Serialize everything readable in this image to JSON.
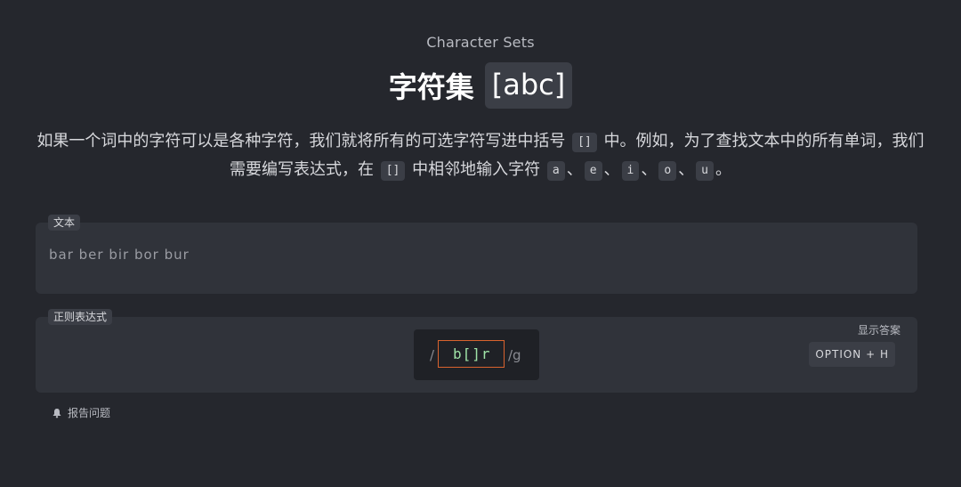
{
  "header": {
    "subtitle": "Character Sets",
    "title": "字符集",
    "title_chip": "[abc]"
  },
  "description": {
    "part1": "如果一个词中的字符可以是各种字符，我们就将所有的可选字符写进中括号",
    "chip1": "[]",
    "part2": "中。例如，为了查找文本中的所有单词，我们需要编写表达式，在",
    "chip2": "[]",
    "part3": "中相邻地输入字符",
    "char_a": "a",
    "char_e": "e",
    "char_i": "i",
    "char_o": "o",
    "char_u": "u",
    "separator": "、",
    "end": "。"
  },
  "text_panel": {
    "label": "文本",
    "content": "bar ber bir bor bur"
  },
  "regex_panel": {
    "label": "正则表达式",
    "slash": "/",
    "value": "b[]r",
    "flags": "/g",
    "show_answer": "显示答案",
    "shortcut": "OPTION + H"
  },
  "footer": {
    "report": "报告问题"
  },
  "colors": {
    "background": "#25272d",
    "panel": "#30333a",
    "chip": "#3b3e46",
    "input_border": "#d9632e",
    "regex_text": "#9fe3a7"
  }
}
